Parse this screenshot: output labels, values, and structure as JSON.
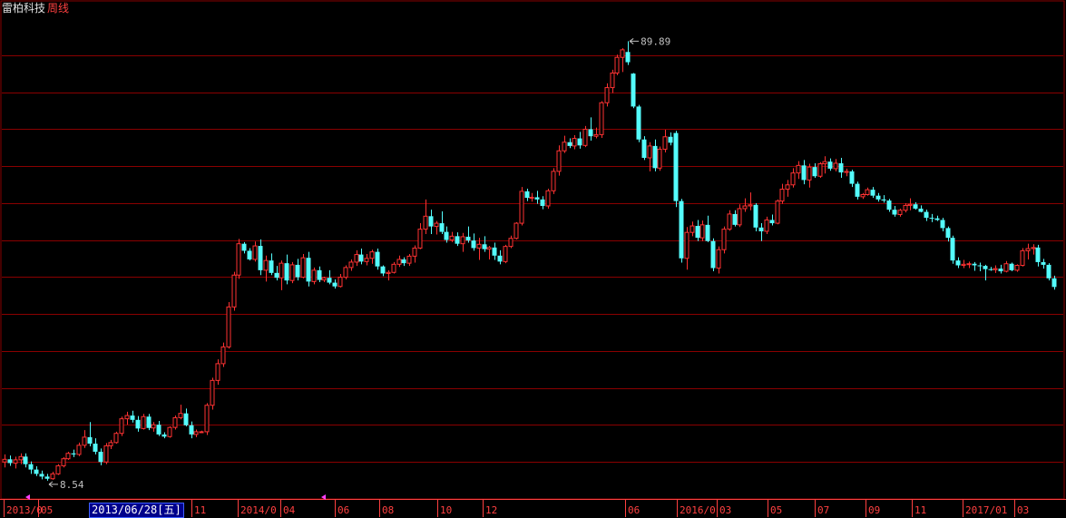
{
  "header": {
    "stock_name": "雷柏科技",
    "period": "周线"
  },
  "cursor_date": "2013/06/28[五]",
  "colors": {
    "background": "#000000",
    "up": "#ff3232",
    "down": "#54fcfc",
    "grid": "#8a0000",
    "axis_text": "#ff4040",
    "annotation": "#c0c0c0"
  },
  "chart_data": {
    "type": "candlestick",
    "ylim": [
      6,
      95
    ],
    "grid": true,
    "x_tick_labels": [
      "2013/0",
      "05",
      "11",
      "2014/0",
      "04",
      "06",
      "08",
      "10",
      "12",
      "06",
      "2016/0",
      "03",
      "05",
      "07",
      "09",
      "11",
      "2017/01",
      "03"
    ],
    "annotations": [
      {
        "label": "89.89",
        "value": 89.89,
        "kind": "high"
      },
      {
        "label": "8.54",
        "value": 8.54,
        "kind": "low"
      }
    ],
    "ohlc": [
      [
        12.0,
        13.4,
        11.0,
        12.5
      ],
      [
        12.5,
        13.2,
        11.3,
        11.8
      ],
      [
        11.8,
        13.0,
        10.8,
        12.4
      ],
      [
        12.4,
        13.6,
        11.6,
        13.0
      ],
      [
        13.0,
        13.6,
        11.0,
        11.6
      ],
      [
        11.6,
        12.1,
        9.8,
        10.6
      ],
      [
        10.6,
        11.2,
        9.4,
        9.8
      ],
      [
        9.8,
        10.4,
        8.8,
        9.3
      ],
      [
        9.3,
        9.8,
        8.54,
        8.9
      ],
      [
        8.9,
        10.2,
        8.7,
        9.8
      ],
      [
        9.8,
        11.6,
        9.6,
        11.3
      ],
      [
        11.3,
        12.9,
        11.0,
        12.6
      ],
      [
        12.6,
        13.9,
        12.4,
        13.6
      ],
      [
        13.6,
        14.3,
        12.9,
        13.4
      ],
      [
        13.4,
        15.6,
        13.1,
        15.1
      ],
      [
        15.1,
        17.9,
        14.6,
        16.6
      ],
      [
        16.6,
        19.4,
        14.9,
        15.4
      ],
      [
        15.4,
        16.4,
        13.4,
        13.9
      ],
      [
        13.9,
        14.5,
        11.4,
        12.0
      ],
      [
        12.0,
        15.5,
        11.6,
        15.0
      ],
      [
        15.0,
        16.1,
        14.4,
        15.6
      ],
      [
        15.6,
        17.6,
        15.4,
        17.3
      ],
      [
        17.3,
        20.4,
        16.8,
        20.0
      ],
      [
        20.0,
        21.3,
        18.9,
        20.6
      ],
      [
        20.6,
        21.5,
        19.3,
        19.8
      ],
      [
        19.8,
        20.5,
        17.6,
        18.2
      ],
      [
        18.2,
        20.9,
        18.0,
        20.4
      ],
      [
        20.4,
        20.9,
        17.9,
        18.3
      ],
      [
        18.3,
        19.4,
        17.6,
        18.9
      ],
      [
        18.9,
        19.6,
        16.8,
        17.1
      ],
      [
        17.1,
        17.5,
        16.4,
        16.7
      ],
      [
        16.7,
        18.6,
        16.5,
        18.4
      ],
      [
        18.4,
        20.6,
        18.0,
        20.2
      ],
      [
        20.2,
        22.6,
        19.9,
        21.0
      ],
      [
        21.0,
        21.9,
        18.6,
        18.8
      ],
      [
        18.8,
        19.5,
        16.4,
        17.1
      ],
      [
        17.1,
        18.0,
        16.6,
        17.6
      ],
      [
        17.6,
        17.8,
        17.4,
        17.6
      ],
      [
        17.6,
        22.9,
        17.0,
        22.5
      ],
      [
        22.5,
        27.6,
        21.7,
        27.1
      ],
      [
        27.1,
        31.0,
        26.3,
        30.2
      ],
      [
        30.2,
        34.1,
        29.6,
        33.3
      ],
      [
        33.3,
        41.6,
        33.0,
        40.7
      ],
      [
        40.7,
        47.2,
        40.0,
        46.6
      ],
      [
        46.6,
        53.3,
        45.9,
        52.4
      ],
      [
        52.4,
        52.7,
        50.6,
        51.1
      ],
      [
        51.1,
        51.6,
        49.3,
        49.5
      ],
      [
        49.5,
        52.8,
        49.1,
        52.0
      ],
      [
        52.0,
        53.2,
        46.6,
        47.5
      ],
      [
        47.5,
        50.2,
        45.4,
        49.3
      ],
      [
        49.3,
        50.6,
        46.6,
        47.0
      ],
      [
        47.0,
        48.3,
        45.6,
        46.1
      ],
      [
        46.1,
        49.3,
        43.8,
        48.8
      ],
      [
        48.8,
        50.4,
        44.9,
        45.6
      ],
      [
        45.6,
        49.0,
        45.1,
        48.5
      ],
      [
        48.5,
        49.6,
        45.6,
        46.2
      ],
      [
        46.2,
        50.5,
        46.0,
        49.8
      ],
      [
        49.8,
        50.9,
        44.5,
        45.4
      ],
      [
        45.4,
        48.0,
        44.9,
        47.5
      ],
      [
        47.5,
        48.2,
        45.3,
        45.7
      ],
      [
        45.7,
        46.3,
        45.3,
        46.1
      ],
      [
        46.1,
        47.5,
        44.9,
        45.2
      ],
      [
        45.2,
        45.8,
        44.1,
        44.5
      ],
      [
        44.5,
        46.8,
        44.3,
        46.2
      ],
      [
        46.2,
        48.4,
        45.8,
        48.0
      ],
      [
        48.0,
        49.5,
        47.4,
        49.0
      ],
      [
        49.0,
        51.2,
        48.3,
        50.4
      ],
      [
        50.4,
        51.5,
        48.6,
        49.1
      ],
      [
        49.1,
        50.5,
        48.4,
        49.7
      ],
      [
        49.7,
        51.3,
        48.7,
        50.9
      ],
      [
        50.9,
        51.5,
        47.6,
        48.2
      ],
      [
        48.2,
        48.4,
        46.4,
        46.9
      ],
      [
        46.9,
        47.5,
        45.6,
        47.1
      ],
      [
        47.1,
        49.0,
        46.9,
        48.6
      ],
      [
        48.6,
        50.2,
        48.1,
        49.5
      ],
      [
        49.5,
        49.9,
        48.3,
        48.8
      ],
      [
        48.8,
        50.5,
        48.3,
        50.1
      ],
      [
        50.1,
        52.1,
        48.9,
        51.6
      ],
      [
        51.6,
        56.2,
        51.4,
        55.1
      ],
      [
        55.1,
        60.6,
        54.2,
        57.5
      ],
      [
        57.5,
        58.7,
        54.2,
        55.6
      ],
      [
        55.6,
        56.6,
        54.1,
        56.2
      ],
      [
        56.2,
        58.4,
        54.2,
        54.6
      ],
      [
        54.6,
        55.6,
        52.6,
        53.1
      ],
      [
        53.1,
        54.6,
        52.7,
        53.8
      ],
      [
        53.8,
        54.5,
        52.0,
        52.4
      ],
      [
        52.4,
        54.4,
        50.9,
        53.7
      ],
      [
        53.7,
        55.6,
        52.6,
        53.0
      ],
      [
        53.0,
        54.3,
        51.1,
        51.6
      ],
      [
        51.6,
        53.5,
        49.4,
        52.3
      ],
      [
        52.3,
        53.8,
        50.9,
        51.4
      ],
      [
        51.4,
        52.0,
        49.5,
        51.7
      ],
      [
        51.7,
        52.6,
        49.4,
        50.2
      ],
      [
        50.2,
        51.2,
        48.6,
        49.1
      ],
      [
        49.1,
        52.2,
        48.8,
        51.9
      ],
      [
        51.9,
        53.9,
        51.6,
        53.4
      ],
      [
        53.4,
        56.4,
        53.2,
        56.2
      ],
      [
        56.2,
        62.9,
        55.8,
        62.1
      ],
      [
        62.1,
        62.6,
        60.3,
        60.9
      ],
      [
        60.9,
        61.8,
        60.2,
        61.0
      ],
      [
        61.0,
        62.2,
        59.8,
        60.6
      ],
      [
        60.6,
        61.2,
        58.8,
        59.4
      ],
      [
        59.4,
        62.6,
        58.9,
        62.2
      ],
      [
        62.2,
        66.4,
        61.6,
        65.8
      ],
      [
        65.8,
        70.6,
        65.0,
        69.6
      ],
      [
        69.6,
        72.4,
        69.2,
        71.2
      ],
      [
        71.2,
        71.9,
        70.1,
        70.5
      ],
      [
        70.5,
        72.5,
        69.9,
        71.9
      ],
      [
        71.9,
        73.1,
        70.0,
        70.6
      ],
      [
        70.6,
        74.2,
        70.3,
        73.6
      ],
      [
        73.6,
        75.8,
        71.5,
        72.3
      ],
      [
        72.3,
        73.9,
        71.9,
        72.6
      ],
      [
        72.6,
        78.8,
        72.0,
        78.5
      ],
      [
        78.5,
        82.1,
        77.8,
        81.3
      ],
      [
        81.3,
        84.6,
        80.3,
        84.0
      ],
      [
        84.0,
        87.4,
        83.6,
        86.9
      ],
      [
        86.9,
        88.6,
        84.2,
        88.3
      ],
      [
        87.9,
        89.89,
        85.5,
        86.0
      ],
      [
        83.9,
        84.0,
        77.5,
        77.8
      ],
      [
        77.8,
        78.1,
        71.2,
        71.7
      ],
      [
        71.7,
        72.3,
        67.9,
        68.3
      ],
      [
        68.3,
        71.2,
        65.8,
        70.5
      ],
      [
        70.5,
        71.7,
        65.8,
        66.4
      ],
      [
        66.4,
        70.4,
        65.9,
        69.9
      ],
      [
        69.9,
        73.5,
        69.3,
        72.2
      ],
      [
        72.2,
        73.0,
        70.6,
        71.1
      ],
      [
        72.9,
        73.3,
        59.2,
        60.3
      ],
      [
        60.3,
        60.7,
        48.9,
        49.7
      ],
      [
        49.7,
        55.5,
        47.6,
        54.5
      ],
      [
        54.5,
        56.5,
        53.8,
        55.7
      ],
      [
        55.7,
        56.8,
        52.9,
        53.5
      ],
      [
        53.5,
        56.7,
        52.9,
        55.9
      ],
      [
        55.9,
        57.6,
        52.7,
        52.9
      ],
      [
        52.9,
        53.4,
        47.3,
        47.9
      ],
      [
        47.9,
        51.9,
        46.9,
        51.3
      ],
      [
        51.3,
        55.6,
        50.6,
        55.1
      ],
      [
        55.1,
        58.6,
        54.8,
        57.9
      ],
      [
        57.9,
        58.6,
        55.6,
        55.9
      ],
      [
        55.9,
        59.7,
        55.5,
        58.9
      ],
      [
        58.9,
        60.8,
        58.3,
        59.4
      ],
      [
        59.4,
        61.9,
        58.6,
        59.6
      ],
      [
        59.6,
        59.9,
        54.7,
        55.4
      ],
      [
        55.4,
        56.2,
        52.9,
        54.7
      ],
      [
        54.7,
        57.4,
        54.2,
        56.8
      ],
      [
        56.8,
        57.8,
        55.8,
        56.2
      ],
      [
        56.2,
        60.6,
        56.0,
        60.3
      ],
      [
        60.3,
        63.5,
        59.8,
        62.5
      ],
      [
        62.5,
        64.2,
        61.1,
        63.3
      ],
      [
        63.3,
        66.4,
        62.8,
        65.5
      ],
      [
        65.5,
        67.7,
        64.4,
        66.9
      ],
      [
        66.9,
        67.9,
        63.4,
        64.2
      ],
      [
        64.2,
        67.2,
        62.8,
        66.6
      ],
      [
        66.6,
        67.3,
        64.6,
        64.9
      ],
      [
        64.9,
        67.5,
        64.6,
        67.2
      ],
      [
        67.2,
        68.6,
        65.4,
        67.6
      ],
      [
        67.6,
        68.2,
        65.9,
        66.3
      ],
      [
        66.3,
        68.1,
        65.8,
        67.3
      ],
      [
        67.3,
        68.3,
        64.6,
        65.6
      ],
      [
        65.6,
        66.3,
        64.9,
        65.8
      ],
      [
        65.8,
        66.1,
        62.9,
        63.5
      ],
      [
        63.5,
        63.9,
        60.6,
        61.1
      ],
      [
        61.1,
        61.8,
        60.7,
        61.5
      ],
      [
        61.5,
        62.8,
        61.3,
        62.4
      ],
      [
        62.4,
        62.9,
        60.9,
        61.3
      ],
      [
        61.3,
        61.8,
        60.2,
        60.6
      ],
      [
        60.6,
        61.4,
        60.0,
        60.4
      ],
      [
        60.4,
        60.7,
        58.3,
        58.7
      ],
      [
        58.7,
        59.4,
        57.4,
        57.8
      ],
      [
        57.8,
        58.9,
        57.4,
        58.6
      ],
      [
        58.6,
        59.9,
        58.2,
        59.5
      ],
      [
        59.5,
        60.8,
        58.6,
        59.7
      ],
      [
        59.7,
        60.1,
        58.7,
        58.9
      ],
      [
        58.9,
        59.5,
        58.2,
        58.3
      ],
      [
        58.3,
        58.7,
        56.6,
        57.2
      ],
      [
        57.2,
        57.9,
        56.4,
        57.1
      ],
      [
        57.1,
        57.6,
        56.6,
        56.8
      ],
      [
        56.8,
        57.2,
        54.7,
        55.3
      ],
      [
        55.3,
        55.6,
        52.8,
        53.5
      ],
      [
        53.5,
        53.9,
        48.7,
        49.3
      ],
      [
        49.3,
        49.9,
        47.9,
        48.4
      ],
      [
        48.4,
        49.4,
        47.9,
        48.6
      ],
      [
        48.6,
        49.1,
        47.9,
        48.7
      ],
      [
        48.7,
        49.0,
        47.4,
        48.4
      ],
      [
        48.4,
        48.9,
        47.3,
        48.3
      ],
      [
        48.3,
        48.5,
        45.6,
        47.7
      ],
      [
        47.7,
        48.1,
        47.4,
        47.6
      ],
      [
        47.6,
        48.4,
        47.0,
        47.8
      ],
      [
        47.8,
        48.5,
        46.9,
        47.3
      ],
      [
        47.3,
        49.2,
        47.1,
        48.7
      ],
      [
        48.7,
        48.9,
        47.3,
        47.5
      ],
      [
        47.5,
        48.6,
        47.2,
        48.4
      ],
      [
        48.4,
        51.6,
        48.2,
        51.1
      ],
      [
        51.1,
        52.4,
        49.5,
        51.5
      ],
      [
        51.5,
        52.3,
        50.4,
        51.7
      ],
      [
        51.7,
        52.2,
        48.2,
        49.0
      ],
      [
        49.0,
        49.6,
        47.8,
        48.5
      ],
      [
        48.5,
        48.8,
        45.6,
        46.0
      ],
      [
        46.0,
        46.5,
        43.9,
        44.4
      ]
    ]
  }
}
